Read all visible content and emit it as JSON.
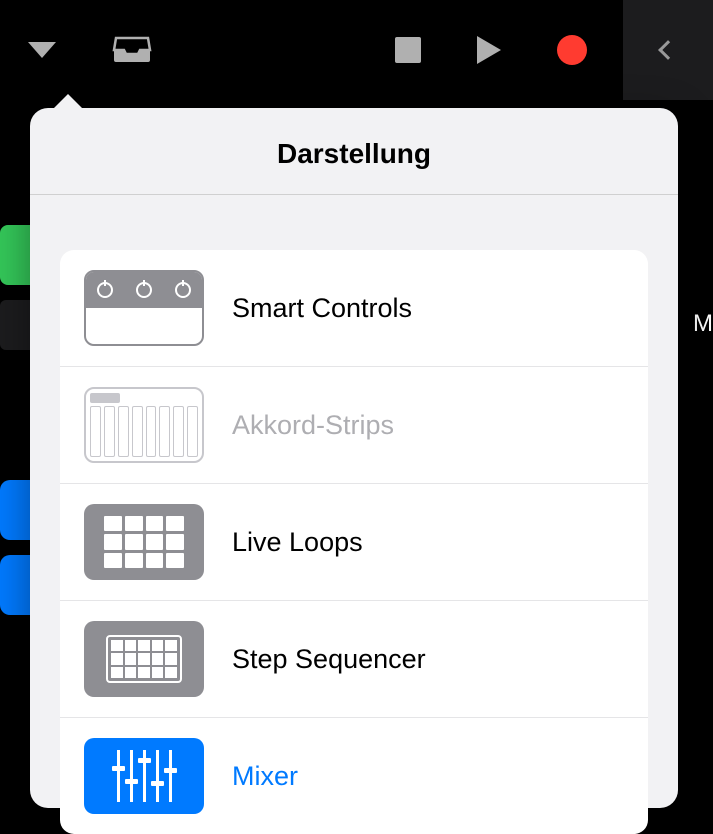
{
  "toolbar": {
    "dropdown": "view-dropdown",
    "inbox": "inbox",
    "stop": "stop",
    "play": "play",
    "record": "record",
    "back": "back"
  },
  "popover": {
    "title": "Darstellung",
    "items": [
      {
        "label": "Smart Controls",
        "state": "enabled"
      },
      {
        "label": "Akkord-Strips",
        "state": "disabled"
      },
      {
        "label": "Live Loops",
        "state": "enabled"
      },
      {
        "label": "Step Sequencer",
        "state": "enabled"
      },
      {
        "label": "Mixer",
        "state": "active"
      }
    ]
  },
  "side_label": "M"
}
